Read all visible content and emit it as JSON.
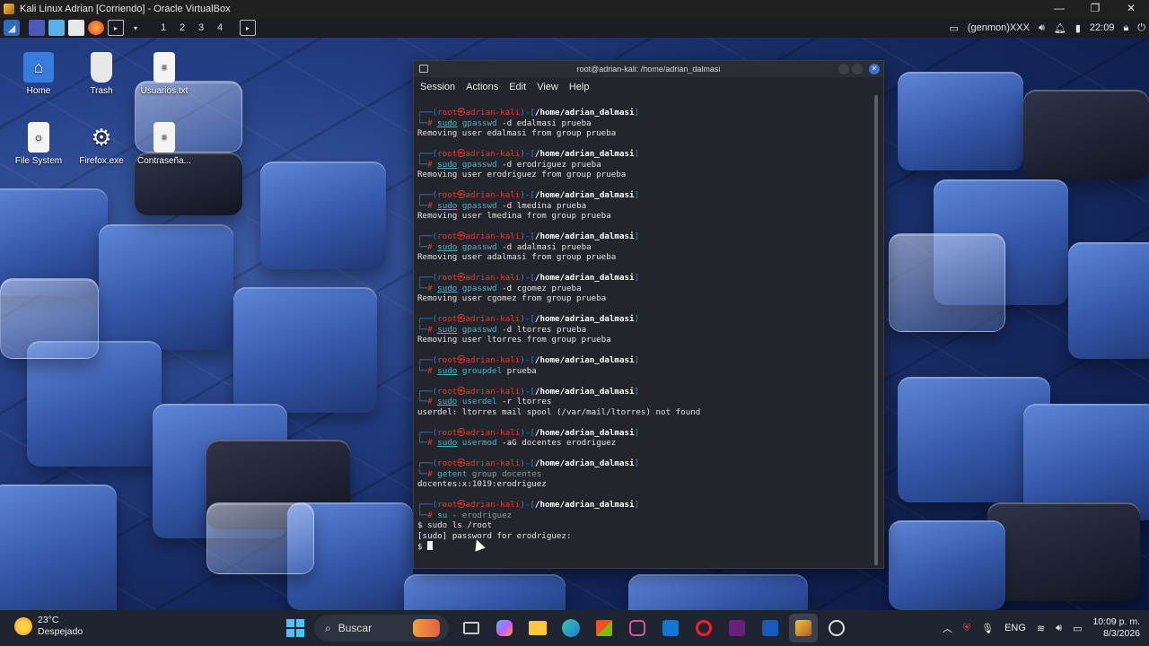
{
  "vbox": {
    "title": "Kali Linux Adrian [Corriendo] - Oracle VirtualBox",
    "minimize": "—",
    "restore": "❐",
    "close": "✕"
  },
  "guest_panel": {
    "workspaces": [
      "1",
      "2",
      "3",
      "4"
    ],
    "genmon": "(genmon)XXX",
    "time": "22:09"
  },
  "desktop_icons": [
    {
      "label": "Home",
      "icon": "home-folder-icon"
    },
    {
      "label": "Trash",
      "icon": "trash-icon"
    },
    {
      "label": "Usuarios.txt",
      "icon": "text-file-icon"
    },
    {
      "label": "File System",
      "icon": "drive-icon"
    },
    {
      "label": "Firefox.exe",
      "icon": "gear-file-icon"
    },
    {
      "label": "Contraseña...",
      "icon": "text-file-icon"
    }
  ],
  "terminal": {
    "title": "root@adrian-kali: /home/adrian_dalmasi",
    "menu": [
      "Session",
      "Actions",
      "Edit",
      "View",
      "Help"
    ],
    "prompt_user": "root㉿adrian-kali",
    "prompt_path": "/home/adrian_dalmasi",
    "blocks": [
      {
        "cmd_sudo": "sudo",
        "cmd": "gpasswd",
        "args": "-d edalmasi prueba",
        "output": [
          "Removing user edalmasi from group prueba"
        ]
      },
      {
        "cmd_sudo": "sudo",
        "cmd": "gpasswd",
        "args": "-d erodriguez prueba",
        "output": [
          "Removing user erodriguez from group prueba"
        ]
      },
      {
        "cmd_sudo": "sudo",
        "cmd": "gpasswd",
        "args": "-d lmedina prueba",
        "output": [
          "Removing user lmedina from group prueba"
        ]
      },
      {
        "cmd_sudo": "sudo",
        "cmd": "gpasswd",
        "args": "-d adalmasi prueba",
        "output": [
          "Removing user adalmasi from group prueba"
        ]
      },
      {
        "cmd_sudo": "sudo",
        "cmd": "gpasswd",
        "args": "-d cgomez prueba",
        "output": [
          "Removing user cgomez from group prueba"
        ]
      },
      {
        "cmd_sudo": "sudo",
        "cmd": "gpasswd",
        "args": "-d ltorres prueba",
        "output": [
          "Removing user ltorres from group prueba"
        ]
      },
      {
        "cmd_sudo": "sudo",
        "cmd": "groupdel",
        "args": "prueba",
        "output": []
      },
      {
        "cmd_sudo": "sudo",
        "cmd": "userdel",
        "args": "-r ltorres",
        "output": [
          "userdel: ltorres mail spool (/var/mail/ltorres) not found"
        ]
      },
      {
        "cmd_sudo": "sudo",
        "cmd": "usermod",
        "args": "-aG docentes erodriguez",
        "output": []
      },
      {
        "cmd_sudo": "",
        "cmd": "getent",
        "args": "group docentes",
        "output": [
          "docentes:x:1019:erodriguez"
        ]
      },
      {
        "cmd_sudo": "",
        "cmd": "su",
        "args": "- erodriguez",
        "output": [
          "$ sudo ls /root",
          "[sudo] password for erodriguez:"
        ]
      }
    ],
    "final_prompt": "$ "
  },
  "taskbar": {
    "temperature": "23°C",
    "weather": "Despejado",
    "search_placeholder": "Buscar",
    "language": "ENG",
    "time": "10:09 p. m.",
    "date": "8/3/2026"
  }
}
